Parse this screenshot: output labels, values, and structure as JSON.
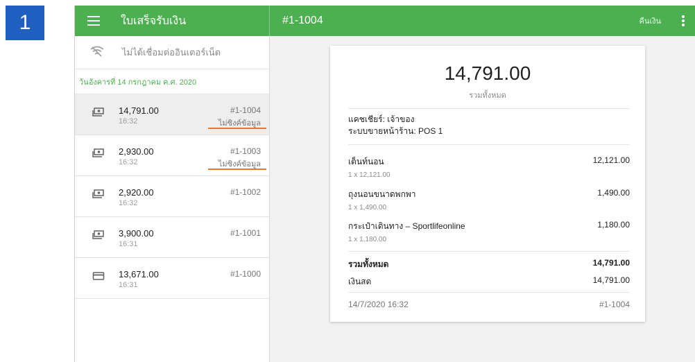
{
  "step_badge": "1",
  "header": {
    "app_title": "ใบเสร็จรับเงิน",
    "receipt_id": "#1-1004",
    "refund_label": "คืนเงิน"
  },
  "sidebar": {
    "offline_text": "ไม่ได้เชื่อมต่ออินเตอร์เน็ต",
    "date_header": "วันอังคารที่ 14 กรกฎาคม ค.ศ. 2020",
    "items": [
      {
        "amount": "14,791.00",
        "time": "16:32",
        "number": "#1-1004",
        "status": "ไม่ซิงค์ข้อมูล",
        "icon": "cash-icon"
      },
      {
        "amount": "2,930.00",
        "time": "16:32",
        "number": "#1-1003",
        "status": "ไม่ซิงค์ข้อมูล",
        "icon": "cash-icon"
      },
      {
        "amount": "2,920.00",
        "time": "16:32",
        "number": "#1-1002",
        "status": "",
        "icon": "cash-icon"
      },
      {
        "amount": "3,900.00",
        "time": "16:31",
        "number": "#1-1001",
        "status": "",
        "icon": "cash-icon"
      },
      {
        "amount": "13,671.00",
        "time": "16:31",
        "number": "#1-1000",
        "status": "",
        "icon": "card-icon"
      }
    ]
  },
  "receipt": {
    "total": "14,791.00",
    "total_label": "รวมทั้งหมด",
    "cashier": "แคชเชียร์: เจ้าของ",
    "pos": "ระบบขายหน้าร้าน: POS 1",
    "lines": [
      {
        "name": "เต็นท์นอน",
        "qty": "1 x 12,121.00",
        "amount": "12,121.00"
      },
      {
        "name": "ถุงนอนขนาดพกพา",
        "qty": "1 x 1,490.00",
        "amount": "1,490.00"
      },
      {
        "name": "กระเป๋าเดินทาง – Sportlifeonline",
        "qty": "1 x 1,180.00",
        "amount": "1,180.00"
      }
    ],
    "grand_total_label": "รวมทั้งหมด",
    "grand_total": "14,791.00",
    "cash_label": "เงินสด",
    "cash": "14,791.00",
    "datetime": "14/7/2020 16:32",
    "number": "#1-1004"
  },
  "colors": {
    "accent": "#4caf50",
    "badge": "#1f5fbf",
    "highlight": "#e8782a"
  }
}
